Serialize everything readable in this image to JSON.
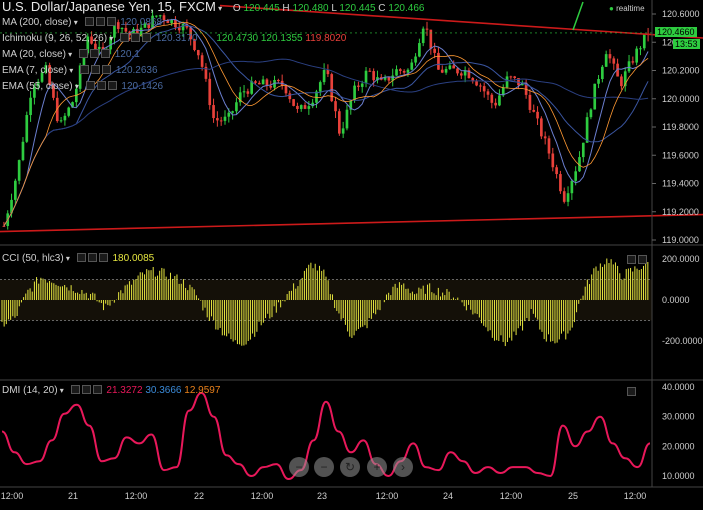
{
  "header": {
    "title": "U.S. Dollar/Japanese Yen, 15, FXCM",
    "open_label": "O",
    "open": "120.445",
    "high_label": "H",
    "high": "120.480",
    "low_label": "L",
    "low": "120.445",
    "close_label": "C",
    "close": "120.466",
    "realtime": "realtime"
  },
  "indicators": [
    {
      "label": "MA (200, close)",
      "value": "120.0868",
      "color": "#4a6aa0"
    },
    {
      "label": "Ichimoku (9, 26, 52, 26)",
      "values": [
        "120.3170",
        "120.4730",
        "120.1355",
        "119.8020"
      ],
      "colors": [
        "#4a6aa0",
        "#2ecc40",
        "#2ecc40",
        "#e8413a"
      ]
    },
    {
      "label": "MA (20, close)",
      "value": "120.1"
    },
    {
      "label": "EMA (7, close)",
      "value": "120.2636",
      "color": "#4a6aa0"
    },
    {
      "label": "EMA (55, close)",
      "value": "120.1426",
      "color": "#4a6aa0"
    }
  ],
  "price_axis": {
    "ticks": [
      "120.6000",
      "120.4000",
      "120.2000",
      "120.0000",
      "119.8000",
      "119.6000",
      "119.4000",
      "119.2000",
      "119.0000"
    ],
    "last_price": "120.4660",
    "countdown": "13:53",
    "colors": {
      "up": "#2ecc40",
      "down": "#e8413a",
      "trendline": "#cc1a1a",
      "tag": "#2ecc40"
    }
  },
  "cci": {
    "label": "CCI (50, hlc3)",
    "value": "180.0085",
    "ticks": [
      "200.0000",
      "0.0000",
      "-200.0000"
    ],
    "color": "#e6e640"
  },
  "dmi": {
    "label": "DMI (14, 20)",
    "values": [
      "21.3272",
      "30.3666",
      "12.9597"
    ],
    "value_colors": [
      "#e8185a",
      "#3a8ad8",
      "#e8801a"
    ],
    "ticks": [
      "40.0000",
      "30.0000",
      "20.0000",
      "10.0000"
    ],
    "color": "#e8185a"
  },
  "x_axis": {
    "labels": [
      "12:00",
      "21",
      "12:00",
      "22",
      "12:00",
      "23",
      "12:00",
      "24",
      "12:00",
      "25",
      "12:00"
    ]
  },
  "nav": {
    "buttons": [
      "zoom-out",
      "zoom-in",
      "reset",
      "scroll-left",
      "scroll-right"
    ]
  },
  "chart_data": [
    {
      "type": "candlestick",
      "title": "U.S. Dollar/Japanese Yen, 15, FXCM",
      "ylim": [
        119.0,
        120.65
      ],
      "x": [
        "20 12:00",
        "21",
        "21 12:00",
        "22",
        "22 12:00",
        "23",
        "23 12:00",
        "24",
        "24 12:00",
        "25",
        "25 12:00"
      ],
      "close_path": [
        119.1,
        119.5,
        120.1,
        120.2,
        119.8,
        120.0,
        120.45,
        120.3,
        120.55,
        120.45,
        120.5,
        120.6,
        120.55,
        120.5,
        120.3,
        119.85,
        119.85,
        120.05,
        120.1,
        120.1,
        120.1,
        119.9,
        120.0,
        120.2,
        119.75,
        120.05,
        120.2,
        120.1,
        120.2,
        120.2,
        120.55,
        120.2,
        120.2,
        120.2,
        120.1,
        119.95,
        120.15,
        120.1,
        119.85,
        119.6,
        119.3,
        119.55,
        120.0,
        120.35,
        120.1,
        120.3,
        120.47
      ],
      "last": 120.466
    },
    {
      "type": "bar",
      "title": "CCI (50, hlc3)",
      "ylim": [
        -250,
        250
      ],
      "values": [
        -120,
        -90,
        40,
        110,
        95,
        70,
        50,
        20,
        -40,
        30,
        80,
        130,
        140,
        120,
        90,
        30,
        -80,
        -150,
        -210,
        -200,
        -120,
        -60,
        20,
        90,
        180,
        120,
        -60,
        -170,
        -140,
        -60,
        40,
        80,
        30,
        60,
        40,
        20,
        -30,
        -90,
        -170,
        -210,
        -160,
        -60,
        -180,
        -200,
        -150,
        40,
        160,
        200,
        120,
        150,
        180
      ]
    },
    {
      "type": "line",
      "title": "DMI (14, 20)",
      "ylim": [
        7,
        42
      ],
      "series": [
        {
          "name": "",
          "values": [
            25,
            18,
            14,
            15,
            22,
            31,
            34,
            27,
            15,
            16,
            23,
            21,
            24,
            12,
            13,
            32,
            38,
            30,
            17,
            14,
            10,
            13,
            14,
            9,
            12,
            22,
            35,
            25,
            18,
            22,
            14,
            10,
            15,
            21,
            13,
            12,
            18,
            15,
            11,
            13,
            11,
            13,
            13,
            11,
            10,
            27,
            20,
            25,
            30,
            21,
            16,
            13,
            21
          ]
        }
      ]
    }
  ]
}
